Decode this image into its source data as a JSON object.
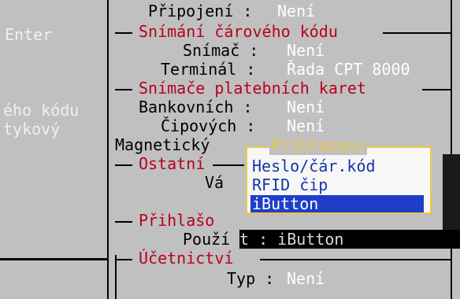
{
  "left_pane": {
    "lines": [
      "Enter",
      "ého kódu",
      "tykový"
    ]
  },
  "settings": {
    "pripojeni": {
      "label": "Připojení :",
      "value": "Není"
    },
    "section_barcode": "Snímání čárového kódu",
    "snimac": {
      "label": "Snímač :",
      "value": "Není"
    },
    "terminal": {
      "label": "Terminál :",
      "value": "Řada CPT 8000"
    },
    "section_card": "Snímače platebních karet",
    "bankovnich": {
      "label": "Bankovních :",
      "value": "Není"
    },
    "cipovych": {
      "label": "Čipových :",
      "value": "Není"
    },
    "magneticky": {
      "label": "Magnetický"
    },
    "section_other": "Ostatní",
    "va": {
      "label": "Vá"
    },
    "section_login": "Přihlašo",
    "pouzit": {
      "label": "Použí",
      "value": "t : iButton"
    },
    "section_accounting": "Účetnictví",
    "typ": {
      "label": "Typ :",
      "value": "Není"
    }
  },
  "popup": {
    "title": "Prihlaseni",
    "options": [
      "Heslo/čár.kód",
      "RFID čip",
      "iButton"
    ],
    "selected_index": 2
  },
  "colors": {
    "background": "#c0c0c0",
    "section": "#b8001f",
    "value": "#ffffff",
    "popup_border": "#e8c84a",
    "option_text": "#1535a8",
    "selection": "#1e3ec8"
  }
}
